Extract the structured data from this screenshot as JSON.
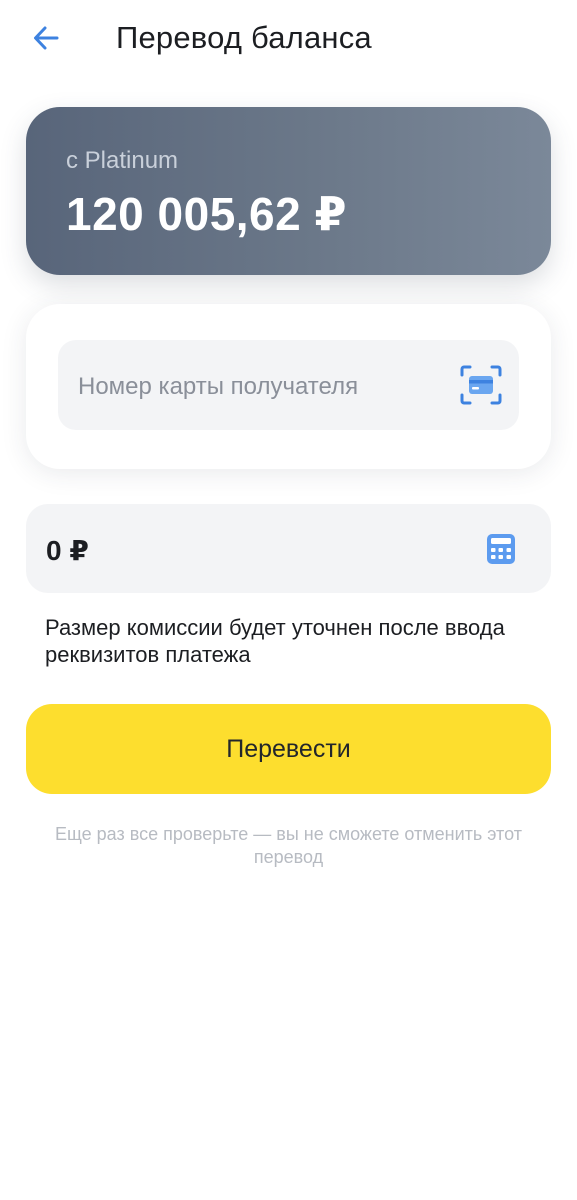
{
  "header": {
    "title": "Перевод баланса",
    "back_icon": "arrow-left-icon"
  },
  "source": {
    "label": "с Platinum",
    "amount": "120 005,62 ₽"
  },
  "recipient": {
    "placeholder": "Номер карты получателя",
    "scan_icon": "card-scan-icon"
  },
  "amount": {
    "value": "0 ₽",
    "calculator_icon": "calculator-icon"
  },
  "commission_note": "Размер комиссии будет уточнен после ввода реквизитов платежа",
  "submit": {
    "label": "Перевести"
  },
  "warning": "Еще раз все проверьте — вы не сможете отменить этот перевод",
  "colors": {
    "accent": "#3d82e0",
    "button": "#fdde2e",
    "card_gradient_start": "#58657a",
    "card_gradient_end": "#7b8899"
  }
}
